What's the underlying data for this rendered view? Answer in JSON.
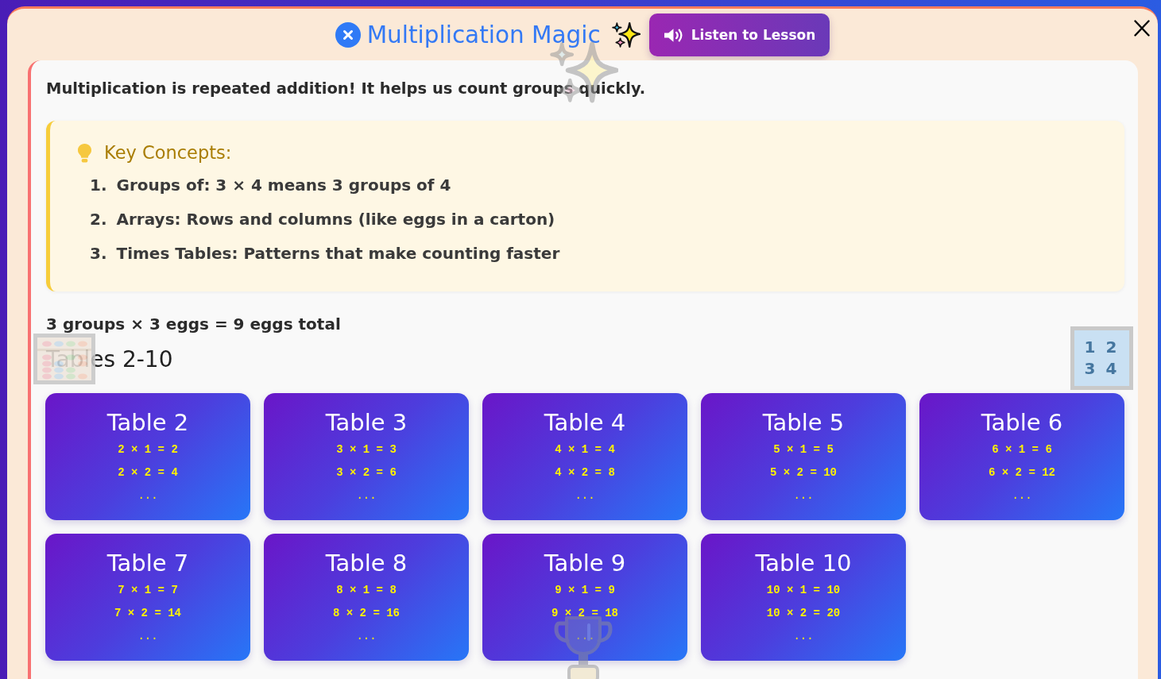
{
  "header": {
    "title": "Multiplication Magic",
    "listen_button": "Listen to Lesson"
  },
  "intro": "Multiplication is repeated addition! It helps us count groups quickly.",
  "key_concepts": {
    "heading": "Key Concepts:",
    "items": [
      {
        "number": "1.",
        "text": "Groups of: 3 × 4 means 3 groups of 4"
      },
      {
        "number": "2.",
        "text": "Arrays: Rows and columns (like eggs in a carton)"
      },
      {
        "number": "3.",
        "text": "Times Tables: Patterns that make counting faster"
      }
    ]
  },
  "example": "3 groups × 3 eggs = 9 eggs total",
  "number_tile": {
    "lines": [
      "1 2",
      "3 4"
    ]
  },
  "tables": {
    "heading": "Tables 2-10",
    "cards": [
      {
        "title": "Table 2",
        "facts": [
          "2 × 1 = 2",
          "2 × 2 = 4"
        ],
        "more": "..."
      },
      {
        "title": "Table 3",
        "facts": [
          "3 × 1 = 3",
          "3 × 2 = 6"
        ],
        "more": "..."
      },
      {
        "title": "Table 4",
        "facts": [
          "4 × 1 = 4",
          "4 × 2 = 8"
        ],
        "more": "..."
      },
      {
        "title": "Table 5",
        "facts": [
          "5 × 1 = 5",
          "5 × 2 = 10"
        ],
        "more": "..."
      },
      {
        "title": "Table 6",
        "facts": [
          "6 × 1 = 6",
          "6 × 2 = 12"
        ],
        "more": "..."
      },
      {
        "title": "Table 7",
        "facts": [
          "7 × 1 = 7",
          "7 × 2 = 14"
        ],
        "more": "..."
      },
      {
        "title": "Table 8",
        "facts": [
          "8 × 1 = 8",
          "8 × 2 = 16"
        ],
        "more": "..."
      },
      {
        "title": "Table 9",
        "facts": [
          "9 × 1 = 9",
          "9 × 2 = 18"
        ],
        "more": "..."
      },
      {
        "title": "Table 10",
        "facts": [
          "10 × 1 = 10",
          "10 × 2 = 20"
        ],
        "more": "..."
      }
    ]
  }
}
